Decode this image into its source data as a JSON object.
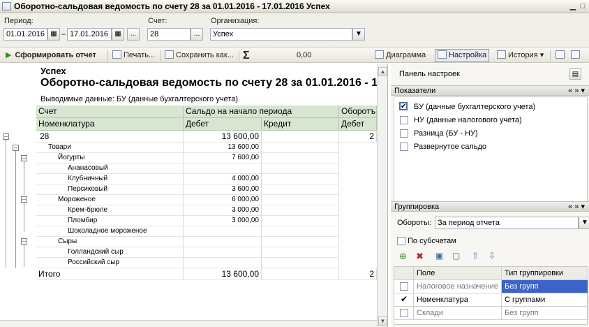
{
  "window": {
    "title": "Оборотно-сальдовая ведомость по счету 28 за 01.01.2016 - 17.01.2016 Успех"
  },
  "params": {
    "period_label": "Период:",
    "date_from": "01.01.2016",
    "date_sep": "–",
    "date_to": "17.01.2016",
    "account_label": "Счет:",
    "account": "28",
    "org_label": "Организация:",
    "organization": "Успех",
    "more_button": "..."
  },
  "toolbar": {
    "generate": "Сформировать отчет",
    "print": "Печать...",
    "save": "Сохранить как...",
    "sum_symbol": "Σ",
    "sum_value": "0,00",
    "chart": "Диаграмма",
    "settings": "Настройка",
    "history": "История"
  },
  "report": {
    "org": "Успех",
    "title": "Оборотно-сальдовая ведомость по счету 28 за 01.01.2016 - 1",
    "output_data": "Выводимые данные:  БУ (данные бухгалтерского учета)",
    "headers": {
      "account": "Счет",
      "opening_balance": "Сальдо на начало периода",
      "turnover": "Оборотъ",
      "nomenclature": "Номенклатура",
      "debit": "Дебет",
      "credit": "Кредит",
      "debit2": "Дебет"
    },
    "rows": [
      {
        "name": "28",
        "debit": "13 600,00",
        "credit": "",
        "extra": "2"
      },
      {
        "name": "Товари",
        "debit": "13 600,00",
        "credit": "",
        "extra": ""
      },
      {
        "name": "Йогурты",
        "debit": "7 600,00",
        "credit": "",
        "extra": ""
      },
      {
        "name": "Ананасовый",
        "debit": "",
        "credit": "",
        "extra": ""
      },
      {
        "name": "Клубничный",
        "debit": "4 000,00",
        "credit": "",
        "extra": ""
      },
      {
        "name": "Персиковый",
        "debit": "3 600,00",
        "credit": "",
        "extra": ""
      },
      {
        "name": "Мороженое",
        "debit": "6 000,00",
        "credit": "",
        "extra": ""
      },
      {
        "name": "Крем-брюле",
        "debit": "3 000,00",
        "credit": "",
        "extra": ""
      },
      {
        "name": "Пломбир",
        "debit": "3 000,00",
        "credit": "",
        "extra": ""
      },
      {
        "name": "Шоколадное мороженое",
        "debit": "",
        "credit": "",
        "extra": ""
      },
      {
        "name": "Сыры",
        "debit": "",
        "credit": "",
        "extra": ""
      },
      {
        "name": "Голландский сыр",
        "debit": "",
        "credit": "",
        "extra": ""
      },
      {
        "name": "Российский сыр",
        "debit": "",
        "credit": "",
        "extra": ""
      }
    ],
    "total": {
      "name": "Итого",
      "debit": "13 600,00",
      "extra": "2"
    }
  },
  "settings_panel": {
    "title": "Панель настроек",
    "indicators_header": "Показатели",
    "indicators": [
      {
        "label": "БУ (данные бухгалтерского учета)",
        "checked": true
      },
      {
        "label": "НУ (данные налогового учета)",
        "checked": false
      },
      {
        "label": "Разница (БУ - НУ)",
        "checked": false
      },
      {
        "label": "Развернутое сальдо",
        "checked": false
      }
    ],
    "grouping_header": "Группировка",
    "turnover_label": "Обороты:",
    "turnover_value": "За период отчета",
    "by_subaccounts": "По субсчетам",
    "grid_headers": {
      "field": "Поле",
      "type": "Тип группировки"
    },
    "grid_rows": [
      {
        "field": "Налоговое назначение",
        "type": "Без групп",
        "checked": false
      },
      {
        "field": "Номенклатура",
        "type": "С группами",
        "checked": true
      },
      {
        "field": "Склади",
        "type": "Без групп",
        "checked": false
      }
    ],
    "nav_arrows": "« » ▾"
  },
  "colors": {
    "header_bg": "#d8e5d1",
    "selection": "#3d63c9"
  }
}
